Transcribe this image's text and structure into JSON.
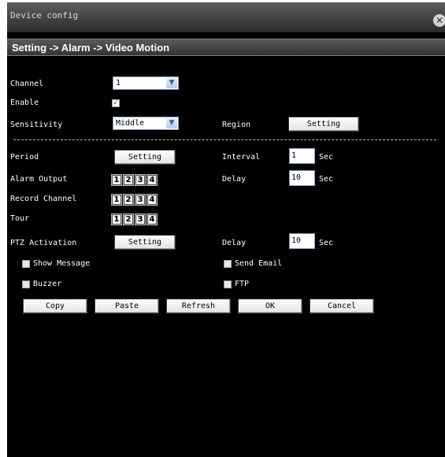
{
  "window": {
    "title": "Device config"
  },
  "breadcrumb": "Setting -> Alarm -> Video Motion",
  "channel": {
    "label": "Channel",
    "value": "1"
  },
  "enable": {
    "label": "Enable",
    "checked": true
  },
  "sensitivity": {
    "label": "Sensitivity",
    "value": "Middle"
  },
  "region": {
    "label": "Region",
    "button": "Setting"
  },
  "period": {
    "label": "Period",
    "button": "Setting"
  },
  "interval": {
    "label": "Interval",
    "value": "1",
    "unit": "Sec"
  },
  "alarm_output": {
    "label": "Alarm Output",
    "numbers": [
      "1",
      "2",
      "3",
      "4"
    ]
  },
  "delay1": {
    "label": "Delay",
    "value": "10",
    "unit": "Sec"
  },
  "record_channel": {
    "label": "Record Channel",
    "numbers": [
      "1",
      "2",
      "3",
      "4"
    ]
  },
  "tour": {
    "label": "Tour",
    "numbers": [
      "1",
      "2",
      "3",
      "4"
    ]
  },
  "ptz": {
    "label": "PTZ Activation",
    "button": "Setting"
  },
  "delay2": {
    "label": "Delay",
    "value": "10",
    "unit": "Sec"
  },
  "show_message": {
    "label": "Show Message",
    "checked": false
  },
  "send_email": {
    "label": "Send Email",
    "checked": false
  },
  "buzzer": {
    "label": "Buzzer",
    "checked": false
  },
  "ftp": {
    "label": "FTP",
    "checked": false
  },
  "actions": {
    "copy": "Copy",
    "paste": "Paste",
    "refresh": "Refresh",
    "ok": "OK",
    "cancel": "Cancel"
  },
  "colors": {
    "background": "#000000",
    "text": "#ffffff",
    "check": "#1a8a1a"
  }
}
